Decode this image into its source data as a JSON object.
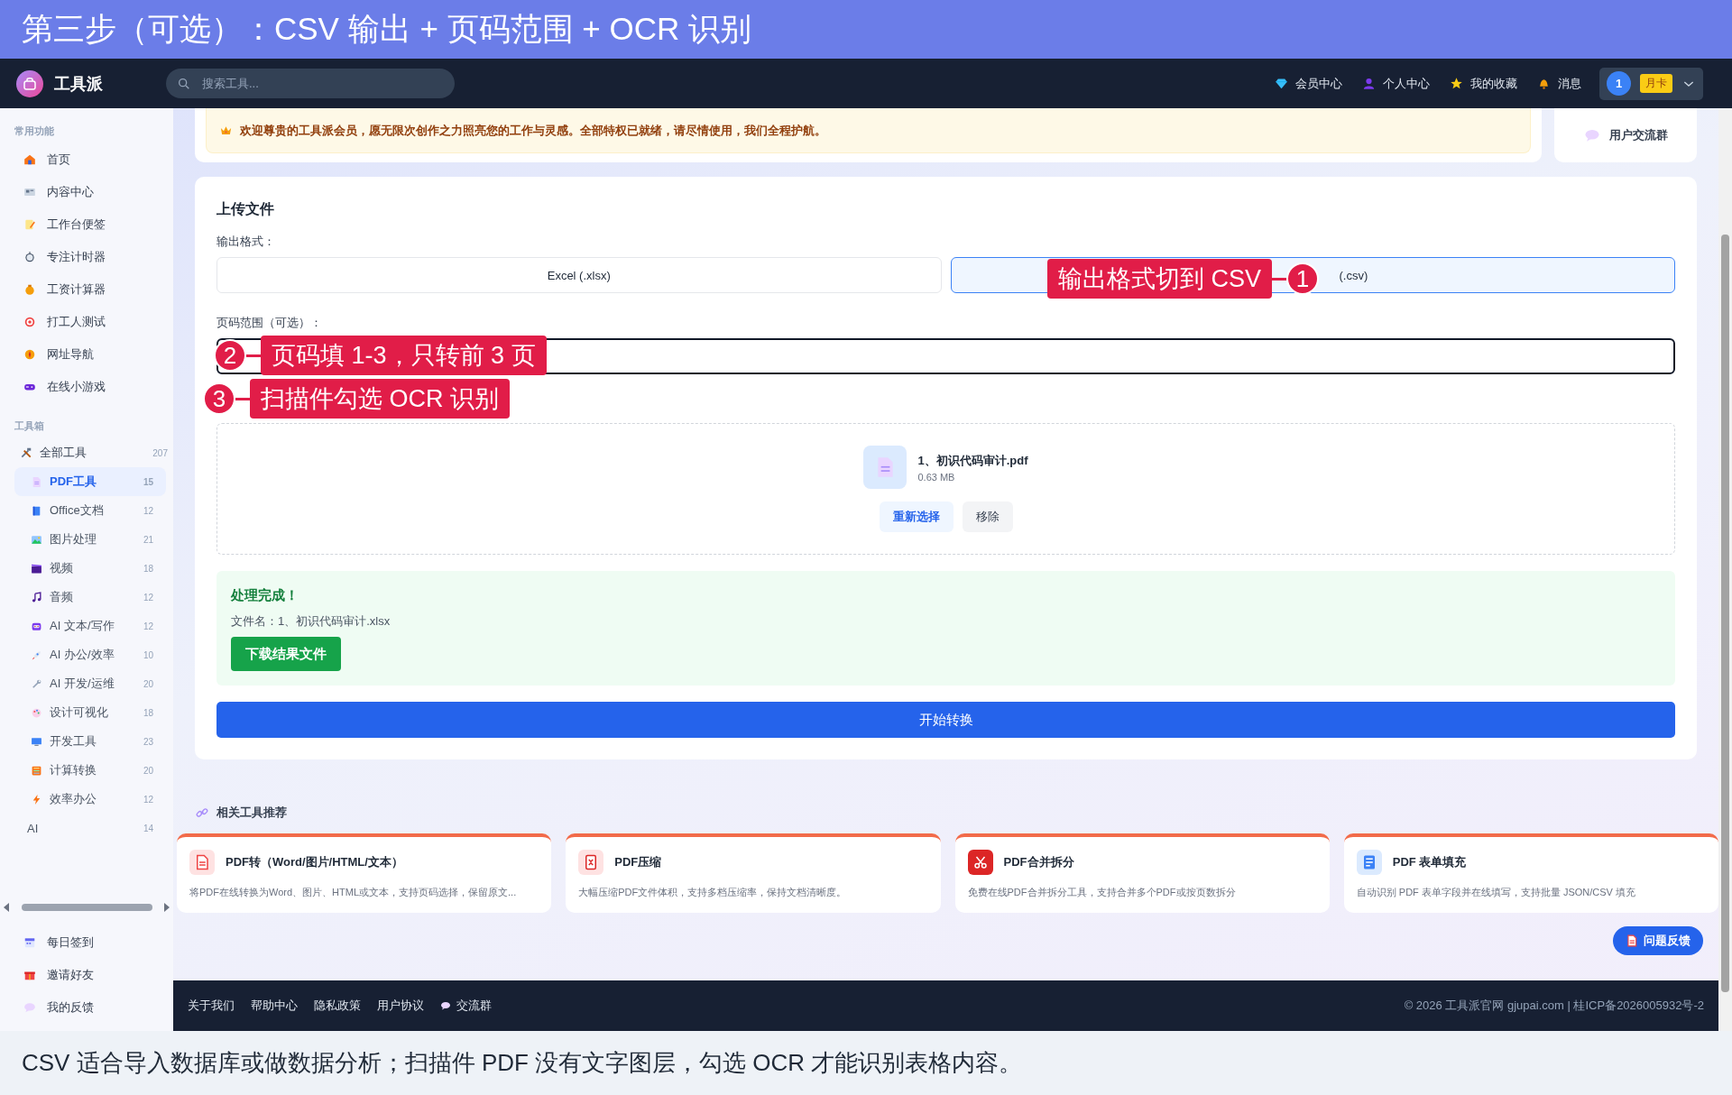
{
  "banner": {
    "title": "第三步（可选）：CSV 输出 + 页码范围 + OCR 识别"
  },
  "header": {
    "logo": "工具派",
    "search": {
      "placeholder": "搜索工具..."
    },
    "nav": [
      {
        "label": "会员中心"
      },
      {
        "label": "个人中心"
      },
      {
        "label": "我的收藏"
      },
      {
        "label": "消息"
      }
    ],
    "user": {
      "avatar": "1",
      "badge": "月卡"
    }
  },
  "sidebar": {
    "sections": [
      {
        "title": "常用功能",
        "items": [
          {
            "label": "首页"
          },
          {
            "label": "内容中心"
          },
          {
            "label": "工作台便签"
          },
          {
            "label": "专注计时器"
          },
          {
            "label": "工资计算器"
          },
          {
            "label": "打工人测试"
          },
          {
            "label": "网址导航"
          },
          {
            "label": "在线小游戏"
          }
        ]
      },
      {
        "title": "工具箱",
        "items": [
          {
            "label": "全部工具",
            "count": "207",
            "children": [
              {
                "kind": "icon",
                "label": "PDF工具",
                "count": "15",
                "selected": true
              },
              {
                "kind": "icon",
                "label": "Office文档",
                "count": "12",
                "selected": false
              },
              {
                "kind": "icon",
                "label": "图片处理",
                "count": "21",
                "selected": false
              },
              {
                "kind": "icon",
                "label": "视频",
                "count": "18",
                "selected": false
              },
              {
                "kind": "icon",
                "label": "音频",
                "count": "12",
                "selected": false
              },
              {
                "kind": "icon",
                "label": "AI 文本/写作",
                "count": "12",
                "selected": false
              },
              {
                "kind": "icon",
                "label": "AI 办公/效率",
                "count": "10",
                "selected": false
              },
              {
                "kind": "icon",
                "label": "AI 开发/运维",
                "count": "20",
                "selected": false
              },
              {
                "kind": "icon",
                "label": "设计可视化",
                "count": "18",
                "selected": false
              },
              {
                "kind": "icon",
                "label": "开发工具",
                "count": "23",
                "selected": false
              },
              {
                "kind": "icon",
                "label": "计算转换",
                "count": "20",
                "selected": false
              },
              {
                "kind": "icon",
                "label": "效率办公",
                "count": "12",
                "selected": false
              },
              {
                "kind": "plain",
                "label": "AI",
                "count": "14",
                "selected": false
              }
            ]
          }
        ]
      }
    ],
    "bottom_items": [
      {
        "label": "每日签到"
      },
      {
        "label": "邀请好友"
      },
      {
        "label": "我的反馈"
      }
    ]
  },
  "welcome": {
    "text": "欢迎尊贵的工具派会员，愿无限次创作之力照亮您的工作与灵感。全部特权已就绪，请尽情使用，我们全程护航。",
    "group_link": "用户交流群"
  },
  "upload": {
    "title": "上传文件",
    "format_label": "输出格式：",
    "formats": [
      {
        "label": "Excel (.xlsx)",
        "selected": false
      },
      {
        "label": "(.csv)",
        "selected": true
      }
    ],
    "range_label": "页码范围（可选）：",
    "file": {
      "name": "1、初识代码审计.pdf",
      "size": "0.63 MB",
      "buttons": [
        {
          "label": "重新选择",
          "kind": "primary"
        },
        {
          "label": "移除",
          "kind": "secondary"
        }
      ]
    },
    "result": {
      "title": "处理完成！",
      "filename": "文件名：1、初识代码审计.xlsx",
      "download": "下载结果文件"
    },
    "start_button": "开始转换"
  },
  "annotations": [
    {
      "number": "1",
      "text": "输出格式切到 CSV"
    },
    {
      "number": "2",
      "text": "页码填 1-3，只转前 3 页"
    },
    {
      "number": "3",
      "text": "扫描件勾选 OCR 识别"
    }
  ],
  "related": {
    "title": "相关工具推荐",
    "cards": [
      {
        "title": "PDF转（Word/图片/HTML/文本）",
        "description": "将PDF在线转换为Word、图片、HTML或文本，支持页码选择，保留原文..."
      },
      {
        "title": "PDF压缩",
        "description": "大幅压缩PDF文件体积，支持多档压缩率，保持文档清晰度。"
      },
      {
        "title": "PDF合并拆分",
        "description": "免费在线PDF合并拆分工具，支持合并多个PDF或按页数拆分"
      },
      {
        "title": "PDF 表单填充",
        "description": "自动识别 PDF 表单字段并在线填写，支持批量 JSON/CSV 填充"
      }
    ]
  },
  "feedback_button": "问题反馈",
  "footer": {
    "links": [
      "关于我们",
      "帮助中心",
      "隐私政策",
      "用户协议",
      "交流群"
    ],
    "copyright": "© 2026 工具派官网 gjupai.com | 桂ICP备2026005932号-2"
  },
  "caption": "CSV 适合导入数据库或做数据分析；扫描件 PDF 没有文字图层，勾选 OCR 才能识别表格内容。"
}
